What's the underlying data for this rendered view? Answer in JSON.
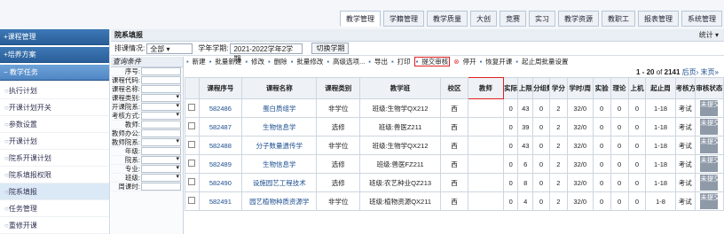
{
  "topnav": {
    "tabs": [
      "教学管理",
      "学籍管理",
      "教学质量",
      "大创",
      "竞赛",
      "实习",
      "教学资源",
      "教职工",
      "报表管理",
      "系统管理"
    ]
  },
  "sidebar": {
    "groups": [
      {
        "label": "课程管理",
        "mark": "+"
      },
      {
        "label": "培养方案",
        "mark": "+"
      },
      {
        "label": "教学任务",
        "mark": "−"
      }
    ],
    "items": [
      "执行计划",
      "开课计划开关",
      "参数设置",
      "开课计划",
      "院系开课计划",
      "院系填报权限",
      "院系填报",
      "任务管理",
      "重修开课"
    ]
  },
  "page": {
    "title": "院系填报",
    "stats": "统计",
    "filter_label": "排课情况:",
    "filter_value": "全部",
    "term_label": "学年学期:",
    "term_value": "2021-2022学年2学期",
    "switch_btn": "切换学期"
  },
  "query": {
    "title": "查询条件",
    "fields": [
      "序号:",
      "课程代码:",
      "课程名称:",
      "课程类别:",
      "开课院系:",
      "考核方式:",
      "教师:",
      "教师办公:",
      "教师院系:",
      "年级:",
      "院系:",
      "专业:",
      "班级:",
      "周课时:"
    ]
  },
  "toolbar": [
    "新建",
    "批量新建",
    "修改",
    "删除",
    "批量修改",
    "高级选项...",
    "导出",
    "打印",
    "提交审核",
    "停开",
    "恢复开课",
    "起止周批量设置"
  ],
  "pager": {
    "range": "1 - 20",
    "of": "of",
    "total": "2141",
    "nav": "后页› 末页»"
  },
  "table": {
    "headers": [
      "",
      "课程序号",
      "课程名称",
      "课程类别",
      "教学班",
      "校区",
      "教师",
      "实际",
      "上限",
      "分组数",
      "学分",
      "学时/周",
      "实验",
      "理论",
      "上机",
      "起止周",
      "考核方式",
      "审核状态"
    ],
    "rows": [
      [
        "582486",
        "蛋白质组学",
        "非学位",
        "班级:生物学QX212",
        "西",
        "",
        "0",
        "43",
        "0",
        "2",
        "32/0",
        "0",
        "0",
        "0",
        "1-18",
        "考试",
        "未提交"
      ],
      [
        "582487",
        "生物信息学",
        "选修",
        "班级:兽医Z211",
        "西",
        "",
        "0",
        "39",
        "0",
        "2",
        "32/0",
        "0",
        "0",
        "0",
        "1-18",
        "考试",
        "未提交"
      ],
      [
        "582488",
        "分子数量遗传学",
        "非学位",
        "班级:生物学QX212",
        "西",
        "",
        "0",
        "43",
        "0",
        "2",
        "32/0",
        "0",
        "0",
        "0",
        "1-18",
        "考试",
        "未提交"
      ],
      [
        "582489",
        "生物信息学",
        "选修",
        "班级:兽医FZ211",
        "西",
        "",
        "0",
        "6",
        "0",
        "2",
        "32/0",
        "0",
        "0",
        "0",
        "1-18",
        "考试",
        "未提交"
      ],
      [
        "582490",
        "设施园艺工程技术",
        "选修",
        "班级:农艺种业QZ213",
        "西",
        "",
        "0",
        "8",
        "0",
        "2",
        "32/0",
        "0",
        "0",
        "0",
        "1-18",
        "考试",
        "未提交"
      ],
      [
        "582491",
        "园艺植物种质资源学",
        "非学位",
        "班级:植物资源QX211",
        "西",
        "",
        "0",
        "4",
        "0",
        "2",
        "32/0",
        "0",
        "0",
        "0",
        "1-8",
        "考试",
        "未提交"
      ]
    ]
  }
}
